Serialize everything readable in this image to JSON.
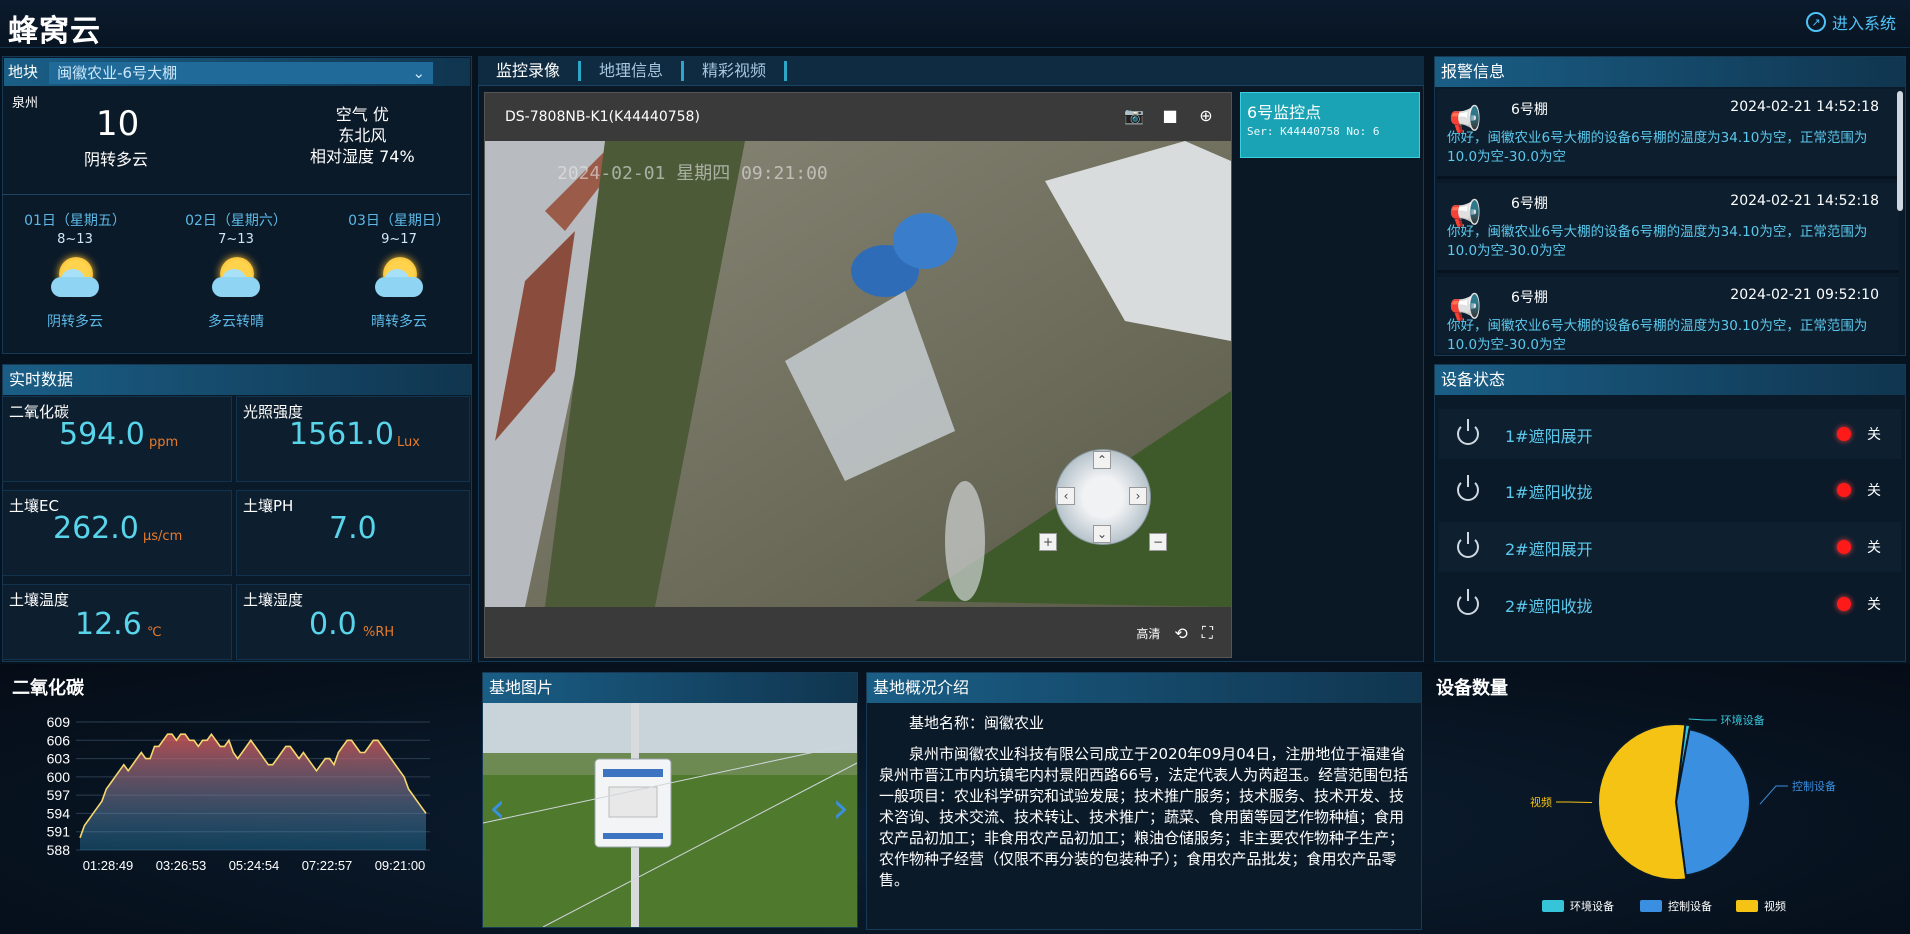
{
  "app": {
    "title": "蜂窝云",
    "enter_label": "进入系统"
  },
  "farm_select": {
    "label": "地块",
    "value": "闽徽农业-6号大棚"
  },
  "weather": {
    "city": "泉州",
    "temp": "10",
    "desc": "阴转多云",
    "air": "空气 优",
    "wind": "东北风",
    "humidity": "相对湿度 74%",
    "forecast": [
      {
        "date": "01日（星期五）",
        "range": "8~13",
        "cond": "阴转多云"
      },
      {
        "date": "02日（星期六）",
        "range": "7~13",
        "cond": "多云转晴"
      },
      {
        "date": "03日（星期日）",
        "range": "9~17",
        "cond": "晴转多云"
      }
    ]
  },
  "realtime": {
    "title": "实时数据",
    "items": [
      {
        "label": "二氧化碳",
        "value": "594.0",
        "unit": "ppm"
      },
      {
        "label": "光照强度",
        "value": "1561.0",
        "unit": "Lux"
      },
      {
        "label": "土壤EC",
        "value": "262.0",
        "unit": "μs/cm"
      },
      {
        "label": "土壤PH",
        "value": "7.0",
        "unit": ""
      },
      {
        "label": "土壤温度",
        "value": "12.6",
        "unit": "℃"
      },
      {
        "label": "土壤湿度",
        "value": "0.0",
        "unit": "%RH"
      }
    ]
  },
  "center": {
    "tabs": [
      "监控录像",
      "地理信息",
      "精彩视频"
    ],
    "video_title": "DS-7808NB-K1(K44440758)",
    "overlay_text": "2024-02-01 星期四 09:21:00",
    "quality": "高清",
    "camera": {
      "name": "6号监控点",
      "serial": "Ser: K44440758 No: 6"
    }
  },
  "alarms": {
    "title": "报警信息",
    "items": [
      {
        "name": "6号棚",
        "time": "2024-02-21 14:52:18",
        "msg": "你好，闽徽农业6号大棚的设备6号棚的温度为34.10为空，正常范围为10.0为空-30.0为空"
      },
      {
        "name": "6号棚",
        "time": "2024-02-21 14:52:18",
        "msg": "你好，闽徽农业6号大棚的设备6号棚的温度为34.10为空，正常范围为10.0为空-30.0为空"
      },
      {
        "name": "6号棚",
        "time": "2024-02-21 09:52:10",
        "msg": "你好，闽徽农业6号大棚的设备6号棚的温度为30.10为空，正常范围为10.0为空-30.0为空"
      }
    ]
  },
  "devices": {
    "title": "设备状态",
    "items": [
      {
        "name": "1#遮阳展开",
        "status": "关"
      },
      {
        "name": "1#遮阳收拢",
        "status": "关"
      },
      {
        "name": "2#遮阳展开",
        "status": "关"
      },
      {
        "name": "2#遮阳收拢",
        "status": "关"
      }
    ]
  },
  "co2_chart_title": "二氧化碳",
  "photo_title": "基地图片",
  "intro": {
    "title": "基地概况介绍",
    "name_line": "基地名称：闽徽农业",
    "text": "泉州市闽徽农业科技有限公司成立于2020年09月04日，注册地位于福建省泉州市晋江市内坑镇宅内村景阳西路66号，法定代表人为芮超玉。经营范围包括一般项目：农业科学研究和试验发展；技术推广服务；技术服务、技术开发、技术咨询、技术交流、技术转让、技术推广；蔬菜、食用菌等园艺作物种植；食用农产品初加工；非食用农产品初加工；粮油仓储服务；非主要农作物种子生产；农作物种子经营（仅限不再分装的包装种子）；食用农产品批发；食用农产品零售。"
  },
  "device_count_title": "设备数量",
  "chart_data": [
    {
      "type": "area",
      "title": "二氧化碳",
      "x": [
        "01:28:49",
        "03:26:53",
        "05:24:54",
        "07:22:57",
        "09:21:00"
      ],
      "yticks": [
        588,
        591,
        594,
        597,
        600,
        603,
        606,
        609
      ],
      "ylim": [
        588,
        609
      ],
      "values": [
        590,
        592,
        593,
        594,
        595,
        596,
        598,
        599,
        600,
        601,
        602,
        601,
        602,
        603,
        604,
        603,
        603,
        605,
        605,
        606,
        607,
        607,
        606,
        607,
        607,
        606,
        606,
        605,
        606,
        606,
        607,
        606,
        605,
        605,
        606,
        604,
        603,
        604,
        605,
        606,
        605,
        604,
        603,
        602,
        602,
        603,
        604,
        605,
        605,
        604,
        603,
        604,
        603,
        602,
        601,
        602,
        603,
        603,
        602,
        604,
        605,
        606,
        606,
        605,
        604,
        604,
        605,
        606,
        606,
        605,
        604,
        603,
        602,
        601,
        600,
        598,
        597,
        596,
        595,
        594
      ]
    },
    {
      "type": "pie",
      "title": "设备数量",
      "legend": [
        "环境设备",
        "控制设备",
        "视频"
      ],
      "values": [
        1,
        45,
        54
      ],
      "colors": [
        "#36c5d8",
        "#3a8fe0",
        "#f5c313"
      ]
    }
  ]
}
